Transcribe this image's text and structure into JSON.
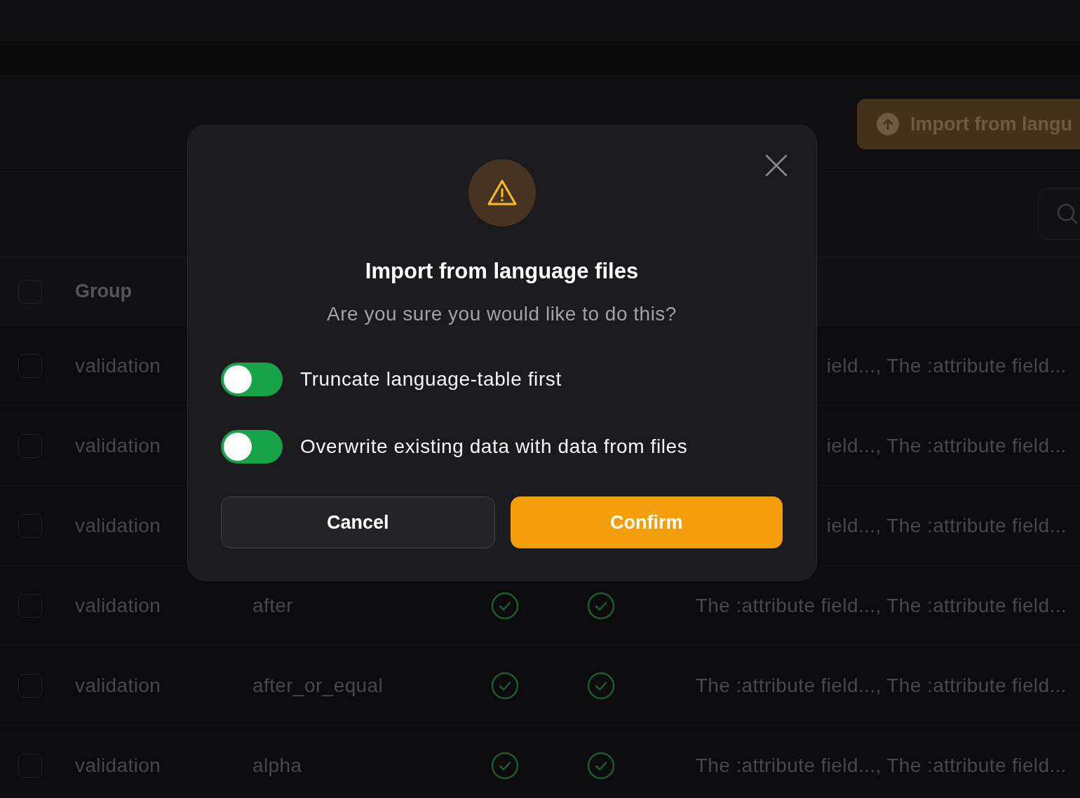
{
  "header": {
    "import_button": "Import from langu"
  },
  "table": {
    "columns": [
      "Group"
    ],
    "header_checked": false,
    "rows": [
      {
        "checked": false,
        "group": "validation",
        "message": "ield..., The :attribute field..."
      },
      {
        "checked": false,
        "group": "validation",
        "message": "ield..., The :attribute field..."
      },
      {
        "checked": false,
        "group": "validation",
        "message": "ield..., The :attribute field..."
      },
      {
        "checked": false,
        "group": "validation",
        "key": "after",
        "check_1": true,
        "check_2": true,
        "message": "The :attribute field..., The :attribute field..."
      },
      {
        "checked": false,
        "group": "validation",
        "key": "after_or_equal",
        "check_1": true,
        "check_2": true,
        "message": "The :attribute field..., The :attribute field..."
      },
      {
        "checked": false,
        "group": "validation",
        "key": "alpha",
        "check_1": true,
        "check_2": true,
        "message": "The :attribute field..., The :attribute field..."
      }
    ]
  },
  "dialog": {
    "title": "Import from language files",
    "message": "Are you sure you would like to do this?",
    "options": [
      {
        "label": "Truncate language-table first",
        "on": true
      },
      {
        "label": "Overwrite existing data with data from files",
        "on": true
      }
    ],
    "buttons": [
      {
        "label": "Cancel",
        "kind": "secondary"
      },
      {
        "label": "Confirm",
        "kind": "primary"
      }
    ]
  }
}
